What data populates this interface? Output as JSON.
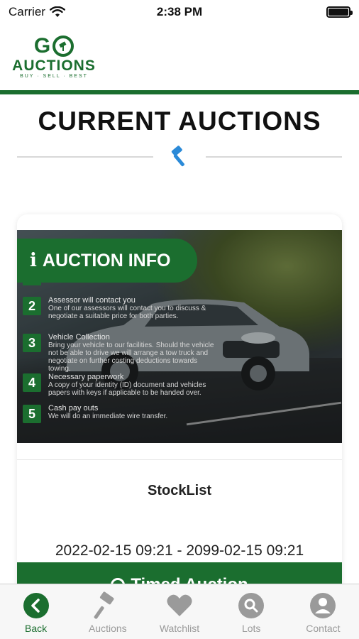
{
  "status_bar": {
    "carrier": "Carrier",
    "time": "2:38 PM"
  },
  "header": {
    "logo": {
      "letters_g": "G",
      "word": "AUCTIONS",
      "tagline": "BUY · SELL · BEST"
    }
  },
  "page": {
    "title": "CURRENT AUCTIONS"
  },
  "auction_card": {
    "banner": {
      "pill_label": "AUCTION INFO",
      "steps": [
        {
          "num": "2",
          "title": "Assessor will contact you",
          "text": "One of our assessors will contact you to discuss & negotiate a suitable price for both parties."
        },
        {
          "num": "3",
          "title": "Vehicle Collection",
          "text": "Bring your vehicle to our facilities. Should the vehicle not be able to drive we will arrange a tow truck and negotiate on further costing deductions towards towing."
        },
        {
          "num": "4",
          "title": "Necessary paperwork",
          "text": "A copy of your identity (ID) document and vehicles papers with keys if applicable to be handed over."
        },
        {
          "num": "5",
          "title": "Cash pay outs",
          "text": "We will do an immediate wire transfer."
        }
      ]
    },
    "name": "StockList",
    "date_range": "2022-02-15 09:21 - 2099-02-15 09:21",
    "button_label": "Timed Auction"
  },
  "tabbar": {
    "tabs": [
      {
        "label": "Back",
        "icon": "back-arrow-icon",
        "active": true
      },
      {
        "label": "Auctions",
        "icon": "gavel-icon",
        "active": false
      },
      {
        "label": "Watchlist",
        "icon": "heart-icon",
        "active": false
      },
      {
        "label": "Lots",
        "icon": "search-icon",
        "active": false
      },
      {
        "label": "Contact",
        "icon": "person-icon",
        "active": false
      }
    ]
  },
  "colors": {
    "brand_green": "#1b6e2f",
    "accent_blue": "#2b8ad8",
    "tab_inactive": "#9a9a9a"
  }
}
